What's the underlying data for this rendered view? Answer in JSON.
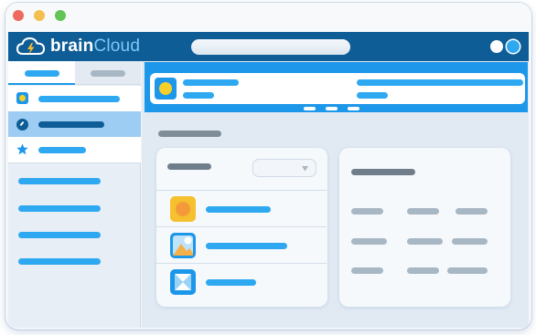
{
  "app": {
    "brand": "brain",
    "brand_accent": "Cloud"
  },
  "colors": {
    "brand_bar": "#0f5d96",
    "accent_blue": "#1d97ea",
    "link_blue": "#2ea8f0",
    "placeholder_gray": "#a8b7c4",
    "dot_red": "#ee6a5f",
    "dot_yellow": "#f5bf4f",
    "dot_green": "#61c454"
  },
  "icons": {
    "logo": "cloud-lightning-icon",
    "window_controls": [
      "close-dot",
      "minimize-dot",
      "zoom-dot"
    ],
    "header_circles": [
      "white-circle-icon",
      "blue-circle-icon"
    ],
    "sidebar": [
      "app-square-icon",
      "gauge-icon",
      "star-icon"
    ],
    "list": [
      "orange-app-icon",
      "image-app-icon",
      "diamond-app-icon"
    ],
    "dropdown": "chevron-down-icon"
  }
}
